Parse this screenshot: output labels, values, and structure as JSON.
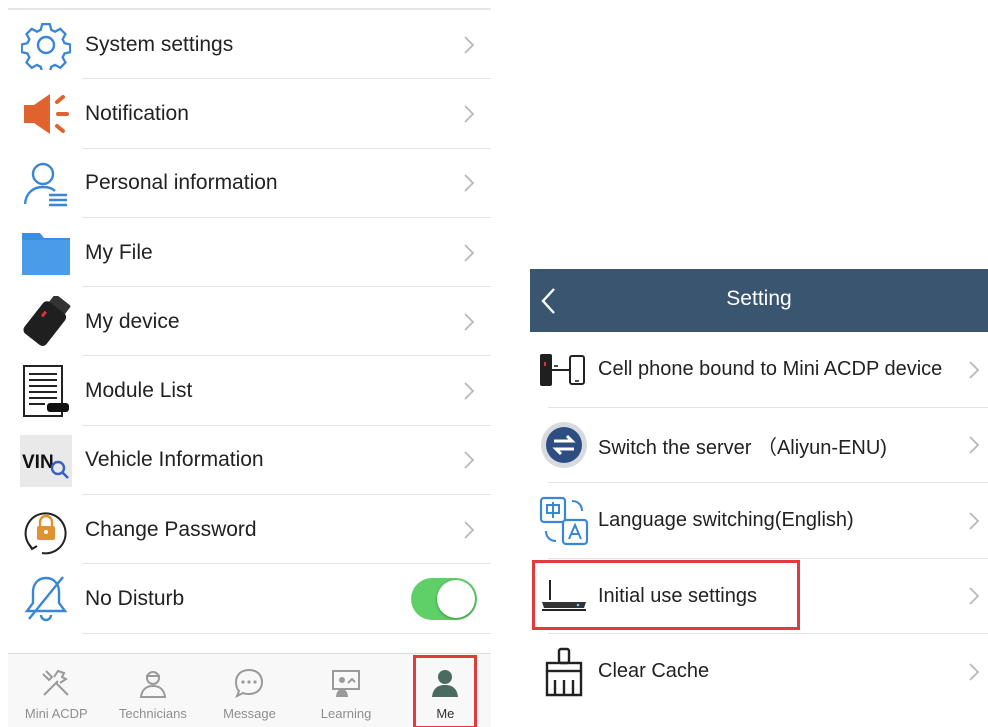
{
  "me_menu": {
    "items": [
      {
        "label": "System settings",
        "icon": "gear-icon"
      },
      {
        "label": "Notification",
        "icon": "speaker-icon"
      },
      {
        "label": "Personal information",
        "icon": "person-icon"
      },
      {
        "label": "My File",
        "icon": "folder-icon"
      },
      {
        "label": "My device",
        "icon": "device-icon"
      },
      {
        "label": "Module List",
        "icon": "document-icon"
      },
      {
        "label": "Vehicle Information",
        "icon": "vin-search-icon",
        "icon_text": "VIN"
      },
      {
        "label": "Change Password",
        "icon": "lock-icon"
      },
      {
        "label": "No Disturb",
        "icon": "bell-off-icon",
        "toggle_on": true
      }
    ]
  },
  "tabbar": {
    "tabs": [
      {
        "label": "Mini ACDP",
        "icon": "tools-icon"
      },
      {
        "label": "Technicians",
        "icon": "technician-icon"
      },
      {
        "label": "Message",
        "icon": "chat-icon"
      },
      {
        "label": "Learning",
        "icon": "learning-icon"
      },
      {
        "label": "Me",
        "icon": "user-icon",
        "active": true
      }
    ]
  },
  "setting": {
    "title": "Setting",
    "items": [
      {
        "label": "Cell phone bound to Mini ACDP device",
        "icon": "phone-device-icon"
      },
      {
        "label": "Switch the server （Aliyun-ENU)",
        "icon": "switch-server-icon"
      },
      {
        "label": "Language switching(English)",
        "icon": "language-icon"
      },
      {
        "label": "Initial use settings",
        "icon": "router-icon"
      },
      {
        "label": "Clear Cache",
        "icon": "broom-icon"
      }
    ]
  },
  "colors": {
    "accent_blue": "#3a86d6",
    "navbar": "#3a5570",
    "toggle_green": "#5fd068",
    "highlight_red": "#e23b3b",
    "notification_orange": "#e0622e"
  }
}
